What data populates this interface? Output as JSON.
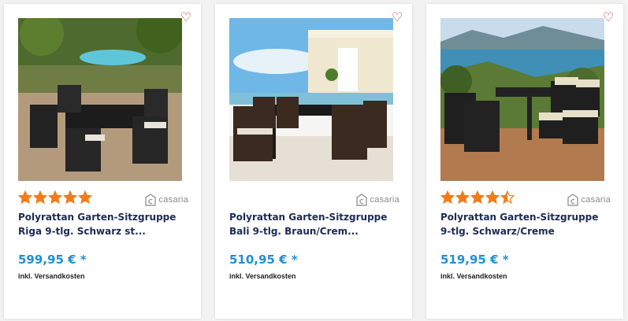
{
  "products": [
    {
      "title": "Polyrattan Garten-Sitzgruppe Riga 9-tlg. Schwarz st...",
      "price": "599,95 € *",
      "shipping": "inkl. Versandkosten",
      "brand": "casaria",
      "rating": 5,
      "wishlist_icon": "heart-outline-icon"
    },
    {
      "title": "Polyrattan Garten-Sitzgruppe Bali 9-tlg. Braun/Crem...",
      "price": "510,95 € *",
      "shipping": "inkl. Versandkosten",
      "brand": "casaria",
      "rating": null,
      "wishlist_icon": "heart-outline-icon"
    },
    {
      "title": "Polyrattan Garten-Sitzgruppe 9-tlg. Schwarz/Creme",
      "price": "519,95 € *",
      "shipping": "inkl. Versandkosten",
      "brand": "casaria",
      "rating": 4.5,
      "wishlist_icon": "heart-outline-icon"
    }
  ],
  "colors": {
    "star": "#f07c1a",
    "price": "#1f8fd6",
    "title": "#1d2a55",
    "heart": "#b7312c"
  }
}
